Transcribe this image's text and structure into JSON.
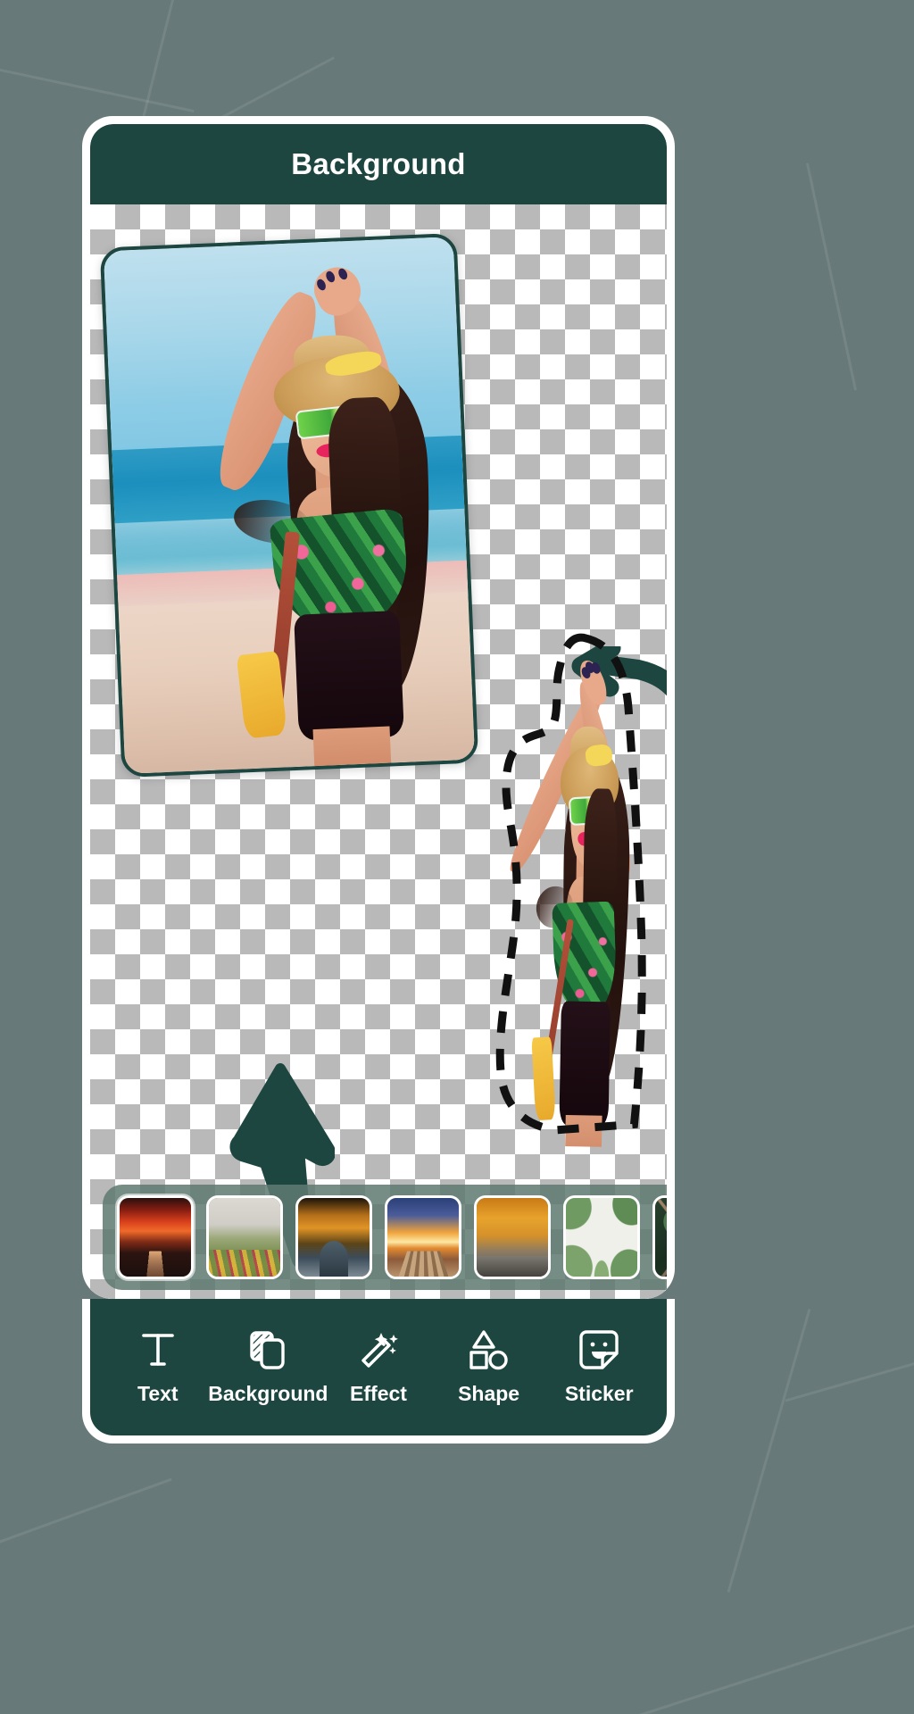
{
  "app": {
    "header": {
      "title": "Background"
    },
    "colors": {
      "brand_dark": "#1d4641",
      "backdrop": "#68797a",
      "strip_bg": "#5f7a72",
      "card_border": "#1d4641",
      "arrow": "#1d4641",
      "text_on_dark": "#ffffff"
    }
  },
  "canvas": {
    "main_photo": {
      "name": "beach-portrait",
      "alt": "Woman in straw hat and floral crop top posing on a beach"
    },
    "cutout": {
      "name": "cutout-subject",
      "alt": "Cut-out of the same woman with dashed selection outline",
      "outline_style": "dashed"
    },
    "annotations": [
      {
        "name": "curved-arrow",
        "direction": "left",
        "shape": "curved"
      },
      {
        "name": "up-arrow",
        "direction": "up",
        "shape": "straight"
      }
    ]
  },
  "background_picker": {
    "selected_index": 0,
    "thumbnails": [
      {
        "id": "bg-1",
        "label": "Sunset cypress road",
        "theme": "t-sunset-road"
      },
      {
        "id": "bg-2",
        "label": "Misty meadow",
        "theme": "t-meadow"
      },
      {
        "id": "bg-3",
        "label": "Autumn forest road",
        "theme": "t-autumn-road"
      },
      {
        "id": "bg-4",
        "label": "Sunrise pier",
        "theme": "t-pier"
      },
      {
        "id": "bg-5",
        "label": "Golden avenue",
        "theme": "t-avenue"
      },
      {
        "id": "bg-6",
        "label": "Leaf frame",
        "theme": "t-leaf-frame"
      },
      {
        "id": "bg-7",
        "label": "Dark tropical leaves",
        "theme": "t-dark-leaf"
      }
    ]
  },
  "toolbar": {
    "items": [
      {
        "label": "Text",
        "icon": "text-icon"
      },
      {
        "label": "Background",
        "icon": "background-icon"
      },
      {
        "label": "Effect",
        "icon": "magic-wand-icon"
      },
      {
        "label": "Shape",
        "icon": "shapes-icon"
      },
      {
        "label": "Sticker",
        "icon": "sticker-icon"
      }
    ]
  }
}
